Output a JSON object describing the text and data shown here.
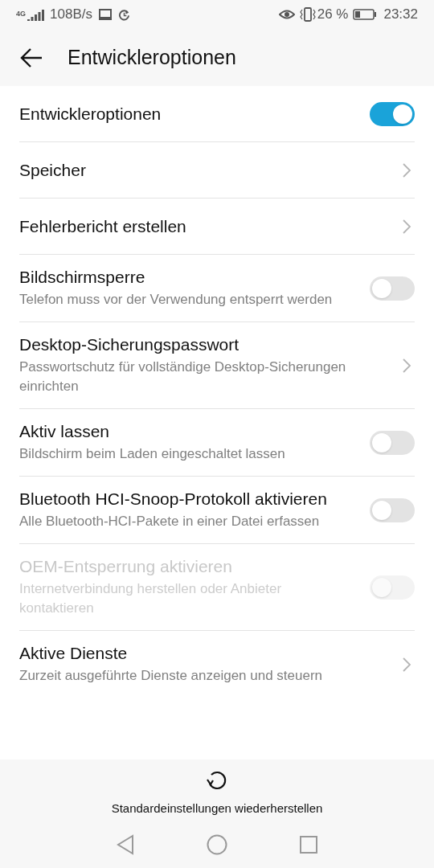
{
  "status_bar": {
    "network": "4G",
    "speed": "108B/s",
    "battery": "26 %",
    "time": "23:32"
  },
  "header": {
    "title": "Entwickleroptionen"
  },
  "items": [
    {
      "kind": "switch",
      "title": "Entwickleroptionen",
      "on": true,
      "disabled": false
    },
    {
      "kind": "link",
      "title": "Speicher",
      "disabled": false
    },
    {
      "kind": "link",
      "title": "Fehlerbericht erstellen",
      "disabled": false
    },
    {
      "kind": "switch",
      "title": "Bildschirmsperre",
      "subtitle": "Telefon muss vor der Verwendung entsperrt werden",
      "on": false,
      "disabled": false
    },
    {
      "kind": "link",
      "title": "Desktop-Sicherungspasswort",
      "subtitle": "Passwortschutz für vollständige Desktop-Sicherungen einrichten",
      "disabled": false
    },
    {
      "kind": "switch",
      "title": "Aktiv lassen",
      "subtitle": "Bildschirm beim Laden eingeschaltet lassen",
      "on": false,
      "disabled": false
    },
    {
      "kind": "switch",
      "title": "Bluetooth HCI-Snoop-Protokoll aktivieren",
      "subtitle": "Alle Bluetooth-HCI-Pakete in einer Datei erfassen",
      "on": false,
      "disabled": false
    },
    {
      "kind": "switch",
      "title": "OEM-Entsperrung aktivieren",
      "subtitle": "Internetverbindung herstellen oder Anbieter kontaktieren",
      "on": false,
      "disabled": true
    },
    {
      "kind": "link",
      "title": "Aktive Dienste",
      "subtitle": "Zurzeit ausgeführte Dienste anzeigen und steuern",
      "disabled": false
    }
  ],
  "reset_button": {
    "label": "Standardeinstellungen wiederherstellen"
  }
}
